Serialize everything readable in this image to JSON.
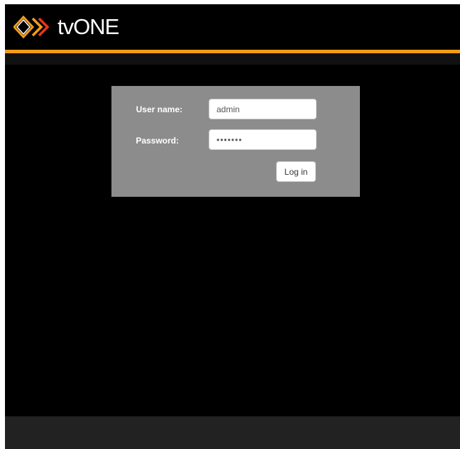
{
  "header": {
    "logo_text": "tvONE",
    "logo_icon": "tvone-chevron-logo",
    "accent_color": "#f39c17"
  },
  "login": {
    "username_label": "User name:",
    "username_value": "admin",
    "password_label": "Password:",
    "password_value": "•••••••",
    "login_button_label": "Log in"
  },
  "colors": {
    "background": "#000000",
    "panel": "#8c8c8c",
    "footer": "#222222"
  }
}
